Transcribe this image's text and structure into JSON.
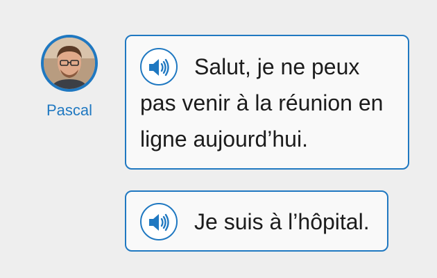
{
  "speaker": {
    "name": "Pascal"
  },
  "messages": [
    {
      "lines": [
        "Salut, je ne peux",
        "pas venir à la réunion en",
        "ligne aujourd’hui."
      ]
    },
    {
      "lines": [
        "Je suis à l’hôpital."
      ]
    }
  ],
  "colors": {
    "accent": "#1f78c1",
    "background": "#eeeeee",
    "bubble": "#f9f9f9",
    "text": "#1c1c1c"
  },
  "icons": {
    "audio": "speaker-icon",
    "avatar": "person-photo"
  }
}
